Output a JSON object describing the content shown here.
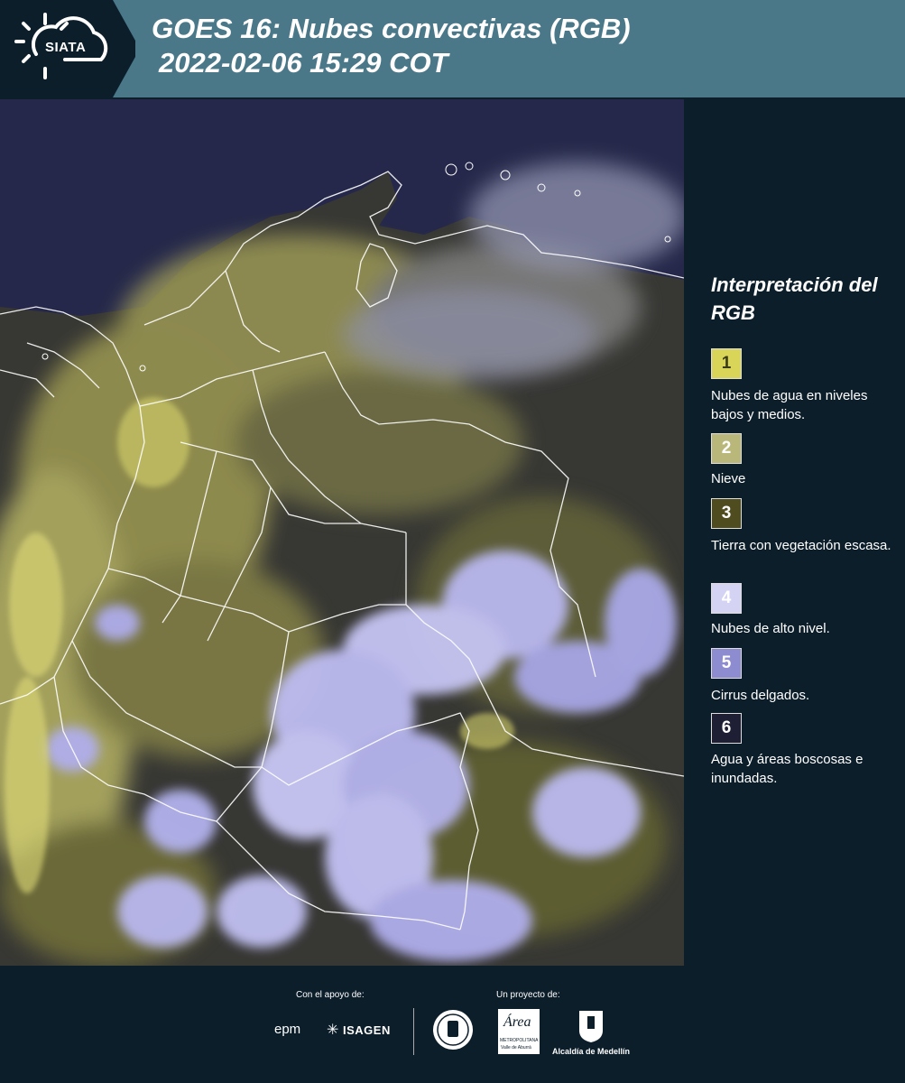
{
  "header": {
    "logo_text": "SIATA",
    "title_line1": "GOES 16: Nubes convectivas (RGB)",
    "title_line2": "2022-02-06 15:29 COT",
    "background_color": "#4a7889"
  },
  "map": {
    "description_icon": "satellite-rgb-image",
    "colors": {
      "background": "#25284a",
      "water_clouds": "#c8c46a",
      "high_clouds": "#b9b8f0",
      "land": "#3b3a3a",
      "borders": "#ffffff"
    }
  },
  "legend": {
    "title": "Interpretación del RGB",
    "items": [
      {
        "number": "1",
        "label": "Nubes de agua en niveles bajos y medios.",
        "color": "#d8d558",
        "text_color": "#3a3a1a"
      },
      {
        "number": "2",
        "label": "Nieve",
        "color": "#b9b87a",
        "text_color": "#ffffff"
      },
      {
        "number": "3",
        "label": "Tierra con vegetación escasa.",
        "color": "#4f4c20",
        "text_color": "#ffffff"
      },
      {
        "number": "4",
        "label": "Nubes de alto nivel.",
        "color": "#d4d3f4",
        "text_color": "#ffffff"
      },
      {
        "number": "5",
        "label": "Cirrus delgados.",
        "color": "#8e8cd0",
        "text_color": "#ffffff"
      },
      {
        "number": "6",
        "label": "Agua y áreas boscosas e inundadas.",
        "color": "#1e1e35",
        "text_color": "#ffffff"
      }
    ]
  },
  "footer": {
    "support_label": "Con el apoyo de:",
    "project_label": "Un proyecto de:",
    "sponsors": [
      "epm",
      "ISAGEN"
    ],
    "partners": [
      "Área Metropolitana Valle de Aburrá",
      "Alcaldía de Medellín"
    ],
    "epm_text": "epm",
    "isagen_text": "ISAGEN",
    "area_text": "Área",
    "area_sub": "METROPOLITANA",
    "area_sub2": "Valle de Aburrá",
    "alcaldia_text": "Alcaldía de Medellín"
  }
}
